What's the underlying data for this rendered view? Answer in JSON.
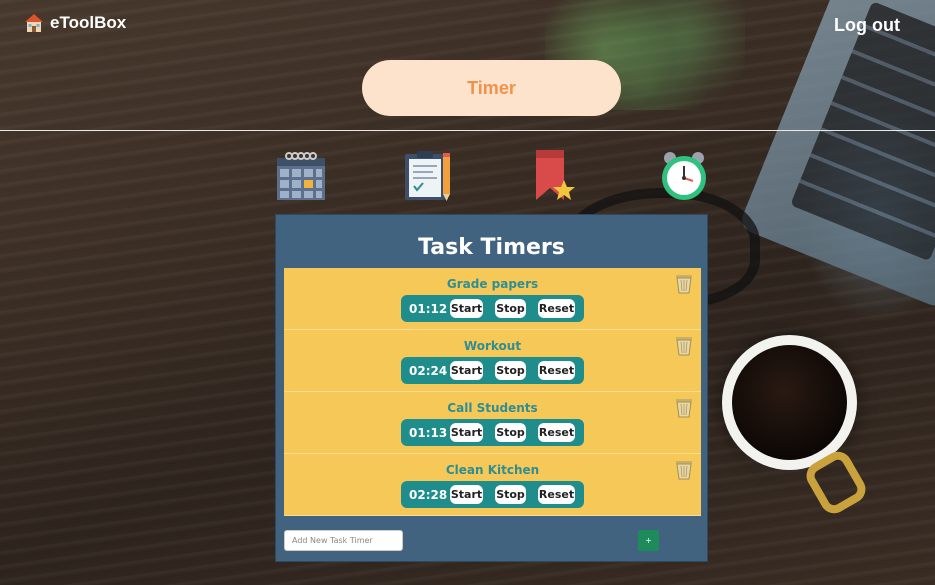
{
  "header": {
    "brand": "eToolBox",
    "logout_label": "Log out",
    "active_tool_label": "Timer"
  },
  "nav": {
    "icons": [
      "calendar-icon",
      "clipboard-checklist-icon",
      "bookmark-star-icon",
      "alarm-clock-icon"
    ]
  },
  "panel": {
    "title": "Task Timers",
    "tasks": [
      {
        "name": "Grade papers",
        "time": "01:12",
        "start": "Start",
        "stop": "Stop",
        "reset": "Reset"
      },
      {
        "name": "Workout",
        "time": "02:24",
        "start": "Start",
        "stop": "Stop",
        "reset": "Reset"
      },
      {
        "name": "Call Students",
        "time": "01:13",
        "start": "Start",
        "stop": "Stop",
        "reset": "Reset"
      },
      {
        "name": "Clean Kitchen",
        "time": "02:28",
        "start": "Start",
        "stop": "Stop",
        "reset": "Reset"
      }
    ],
    "add_placeholder": "Add New Task Timer",
    "add_button_label": "+"
  },
  "colors": {
    "panel_bg": "#426380",
    "task_bg": "#f6c857",
    "task_name": "#2f8e93",
    "control_bg": "#1f8d8c",
    "timer_pill_bg": "#fde3cc",
    "timer_pill_text": "#f0924a",
    "add_button": "#1e8c5a"
  }
}
